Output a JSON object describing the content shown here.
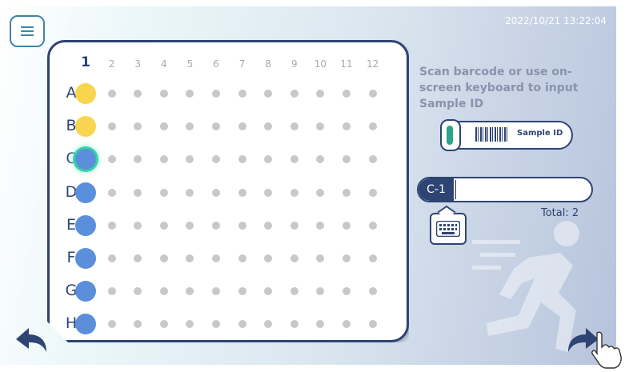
{
  "header": {
    "datetime": "2022/10/21  13:22:04",
    "menu_icon": "hamburger-menu-icon"
  },
  "plate": {
    "columns": [
      "1",
      "2",
      "3",
      "4",
      "5",
      "6",
      "7",
      "8",
      "9",
      "10",
      "11",
      "12"
    ],
    "active_column": "1",
    "rows": [
      "A",
      "B",
      "C",
      "D",
      "E",
      "F",
      "G",
      "H"
    ],
    "wells_column_1": [
      {
        "row": "A",
        "state": "filled",
        "color": "#f8d54e"
      },
      {
        "row": "B",
        "state": "filled",
        "color": "#f8d54e"
      },
      {
        "row": "C",
        "state": "current",
        "color": "#5b8fdc"
      },
      {
        "row": "D",
        "state": "filled",
        "color": "#5b8fdc"
      },
      {
        "row": "E",
        "state": "filled",
        "color": "#5b8fdc"
      },
      {
        "row": "F",
        "state": "filled",
        "color": "#5b8fdc"
      },
      {
        "row": "G",
        "state": "filled",
        "color": "#5b8fdc"
      },
      {
        "row": "H",
        "state": "filled",
        "color": "#5b8fdc"
      }
    ],
    "empty_well_color": "#c8c8c8",
    "current_well_glow": "#34d4a6"
  },
  "side_panel": {
    "instruction": "Scan barcode or use on-screen keyboard to input Sample ID",
    "tube_label": "Sample ID",
    "tube_icon": "sample-tube-barcode-icon",
    "position_tag": "C-1",
    "sample_id_value": "",
    "keyboard_icon": "keyboard-icon",
    "total": "Total: 2"
  },
  "navigation": {
    "back_icon": "back-arrow-icon",
    "next_icon": "forward-arrow-icon",
    "pointer_icon": "hand-pointer-icon"
  },
  "colors": {
    "accent": "#2e4473",
    "menu_border": "#3f86a5"
  }
}
